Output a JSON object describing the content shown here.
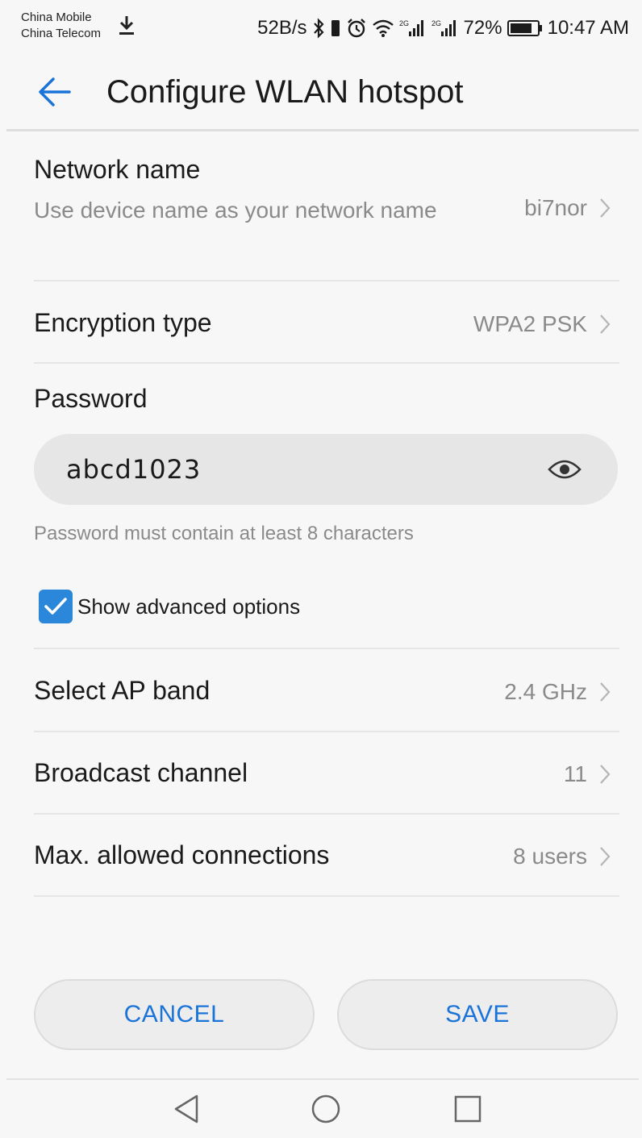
{
  "status_bar": {
    "carrier_1": "China Mobile",
    "carrier_2": "China Telecom",
    "net_speed": "52B/s",
    "battery_percent": "72%",
    "time": "10:47 AM",
    "signal_label_1": "2G",
    "signal_label_2": "2G",
    "icons": [
      "download-icon",
      "bluetooth-icon",
      "vibrate-icon",
      "alarm-icon",
      "wifi-icon",
      "signal-icon",
      "signal-icon",
      "battery-icon"
    ]
  },
  "header": {
    "title": "Configure WLAN hotspot"
  },
  "settings": {
    "network_name": {
      "title": "Network name",
      "subtitle": "Use device name as your network name",
      "value": "bi7nor"
    },
    "encryption_type": {
      "title": "Encryption type",
      "value": "WPA2 PSK"
    },
    "password": {
      "title": "Password",
      "value": "abcd1023",
      "hint": "Password must contain at least 8 characters"
    },
    "advanced": {
      "label": "Show advanced options",
      "checked": true
    },
    "ap_band": {
      "title": "Select AP band",
      "value": "2.4 GHz"
    },
    "broadcast_channel": {
      "title": "Broadcast channel",
      "value": "11"
    },
    "max_connections": {
      "title": "Max. allowed connections",
      "value": "8 users"
    }
  },
  "buttons": {
    "cancel": "CANCEL",
    "save": "SAVE"
  },
  "colors": {
    "accent": "#1a73d9",
    "checkbox": "#2b87d9",
    "background": "#f7f7f7"
  }
}
